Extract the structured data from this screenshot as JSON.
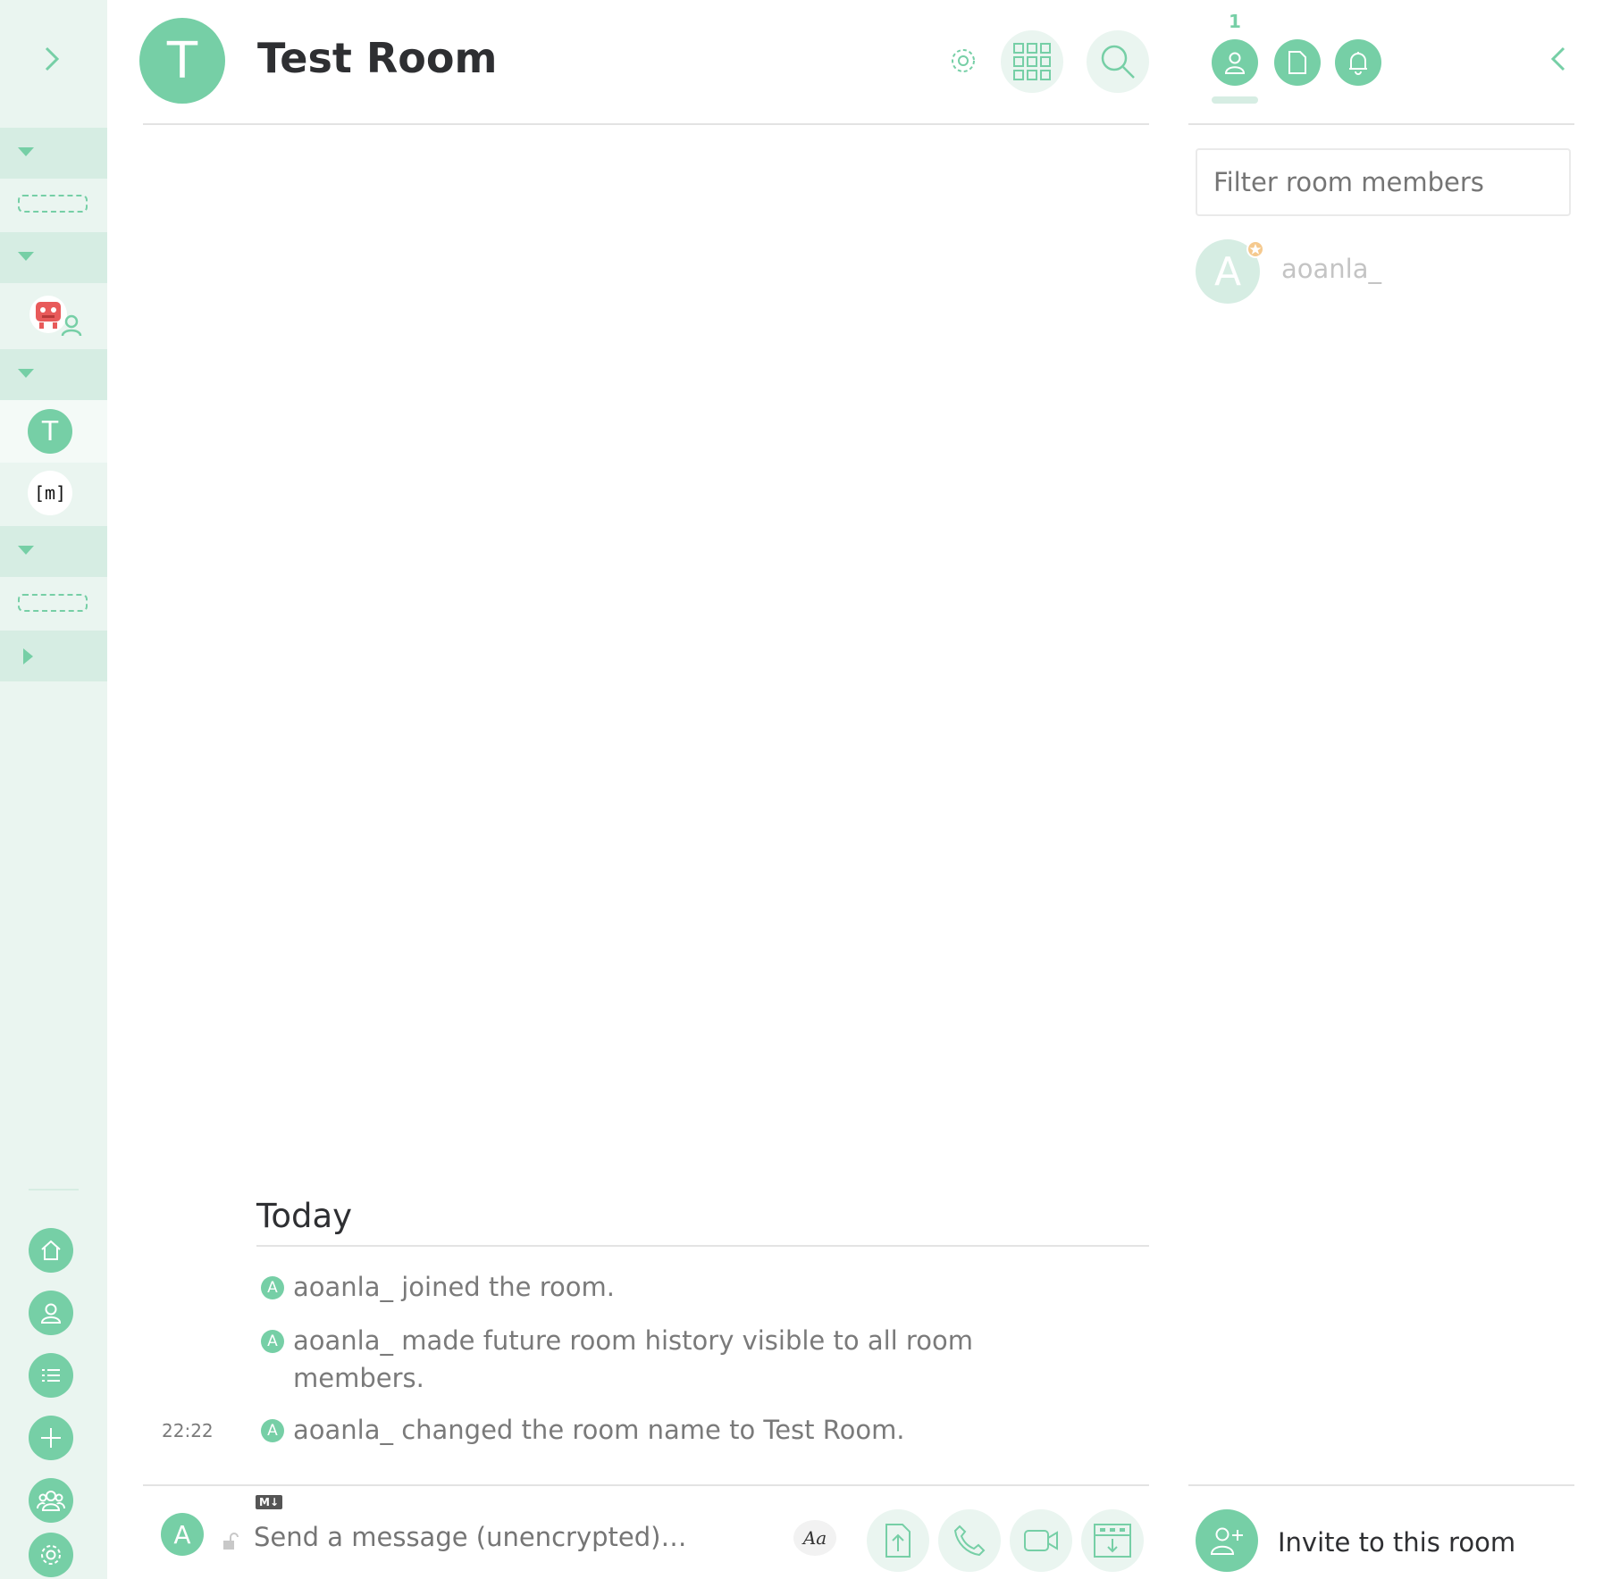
{
  "colors": {
    "accent": "#76cfa6",
    "sidebar_bg": "#eaf5f0",
    "section_bg": "#d6ede3",
    "text": "#2e2f32",
    "muted": "#7a7a7a"
  },
  "sidebar": {
    "expand_icon": "chevron-right-icon",
    "rooms": [
      {
        "letter": "T",
        "selected": true
      },
      {
        "letter": "[m]",
        "selected": false
      }
    ],
    "bottom_icons": [
      "home-icon",
      "user-icon",
      "list-icon",
      "plus-icon",
      "group-icon",
      "gear-icon"
    ]
  },
  "header": {
    "avatar_letter": "T",
    "room_name": "Test Room",
    "icons": [
      "gear-icon",
      "apps-grid-icon",
      "search-icon"
    ]
  },
  "timeline": {
    "date_separator": "Today",
    "events": [
      {
        "avatar": "A",
        "text": "aoanla_ joined the room.",
        "time": ""
      },
      {
        "avatar": "A",
        "text": "aoanla_ made future room history visible to all room",
        "text2": "members.",
        "time": ""
      },
      {
        "avatar": "A",
        "text": "aoanla_ changed the room name to Test Room.",
        "time": "22:22"
      }
    ]
  },
  "composer": {
    "avatar_letter": "A",
    "markdown_badge": "M↓",
    "placeholder": "Send a message (unencrypted)…",
    "format_label": "Aa",
    "icons": [
      "upload-file-icon",
      "phone-icon",
      "video-icon",
      "apps-icon"
    ]
  },
  "right_panel": {
    "member_count": "1",
    "tabs": [
      "members-icon",
      "files-icon",
      "notifications-icon"
    ],
    "collapse_icon": "chevron-left-icon",
    "filter_placeholder": "Filter room members",
    "members": [
      {
        "avatar": "A",
        "name": "aoanla_"
      }
    ],
    "invite_label": "Invite to this room"
  }
}
